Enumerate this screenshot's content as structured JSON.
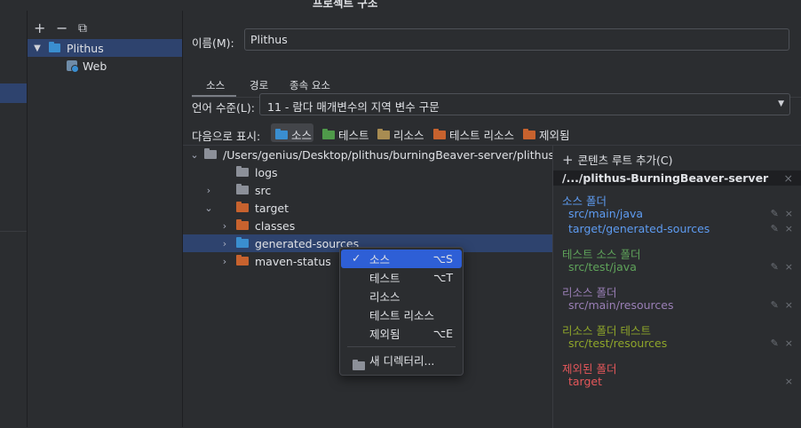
{
  "window": {
    "title": "프로젝트 구조"
  },
  "modules": {
    "toolbar": {
      "add": "+",
      "remove": "−",
      "copy": "⧉"
    },
    "tree": [
      {
        "label": "Plithus"
      },
      {
        "label": "Web"
      }
    ]
  },
  "name_field": {
    "label": "이름(M):",
    "value": "Plithus"
  },
  "tabs": [
    "소스",
    "경로",
    "종속 요소"
  ],
  "language_level": {
    "label": "언어 수준(L):",
    "value": "11 - 람다 매개변수의 지역 변수 구문"
  },
  "mark_as": {
    "label": "다음으로 표시:",
    "buttons": [
      "소스",
      "테스트",
      "리소스",
      "테스트 리소스",
      "제외됨"
    ]
  },
  "file_tree": {
    "root": "/Users/genius/Desktop/plithus/burningBeaver-server/plithus-B",
    "items": [
      "logs",
      "src",
      "target",
      "classes",
      "generated-sources",
      "maven-status"
    ]
  },
  "context_menu": {
    "items": [
      {
        "label": "소스",
        "shortcut": "⌥S",
        "checked": true
      },
      {
        "label": "테스트",
        "shortcut": "⌥T"
      },
      {
        "label": "리소스",
        "shortcut": ""
      },
      {
        "label": "테스트 리소스",
        "shortcut": ""
      },
      {
        "label": "제외됨",
        "shortcut": "⌥E"
      }
    ],
    "new_dir": "새 디렉터리..."
  },
  "right_panel": {
    "add_root": "콘텐츠 루트 추가(C)",
    "root_path": "/.../plithus-BurningBeaver-server",
    "groups": [
      {
        "title": "소스 폴더",
        "color": "#5e9cf2",
        "items": [
          "src/main/java",
          "target/generated-sources"
        ]
      },
      {
        "title": "테스트 소스 폴더",
        "color": "#5fa35a",
        "items": [
          "src/test/java"
        ]
      },
      {
        "title": "리소스 폴더",
        "color": "#9a7fb6",
        "items": [
          "src/main/resources"
        ]
      },
      {
        "title": "리소스 폴더 테스트",
        "color": "#8ea52a",
        "items": [
          "src/test/resources"
        ]
      },
      {
        "title": "제외된 폴더",
        "color": "#e5575a",
        "items": [
          "target"
        ]
      }
    ]
  }
}
